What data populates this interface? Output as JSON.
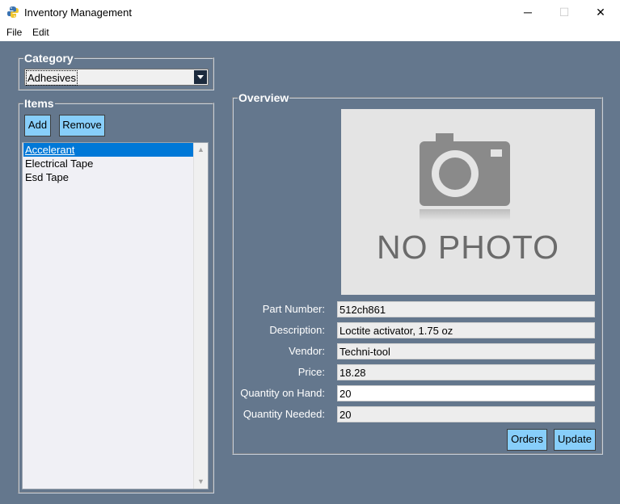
{
  "window": {
    "title": "Inventory Management",
    "minimize_glyph": "─",
    "maximize_glyph": "☐",
    "close_glyph": "✕",
    "app_icon": "python-icon"
  },
  "menu": {
    "items": [
      "File",
      "Edit"
    ]
  },
  "category": {
    "label": "Category",
    "selected": "Adhesives"
  },
  "items": {
    "label": "Items",
    "add_label": "Add",
    "remove_label": "Remove",
    "list": [
      "Accelerant",
      "Electrical Tape",
      "Esd Tape"
    ],
    "selected_index": 0
  },
  "overview": {
    "label": "Overview",
    "photo_text": "NO PHOTO",
    "fields": [
      {
        "label": "Part Number:",
        "value": "512ch861"
      },
      {
        "label": "Description:",
        "value": "Loctite activator, 1.75 oz"
      },
      {
        "label": "Vendor:",
        "value": "Techni-tool"
      },
      {
        "label": "Price:",
        "value": "18.28"
      },
      {
        "label": "Quantity on Hand:",
        "value": "20"
      },
      {
        "label": "Quantity Needed:",
        "value": "20"
      }
    ],
    "orders_label": "Orders",
    "update_label": "Update"
  },
  "colors": {
    "background": "#64778d",
    "button": "#87cefa",
    "selection": "#0078d7"
  }
}
